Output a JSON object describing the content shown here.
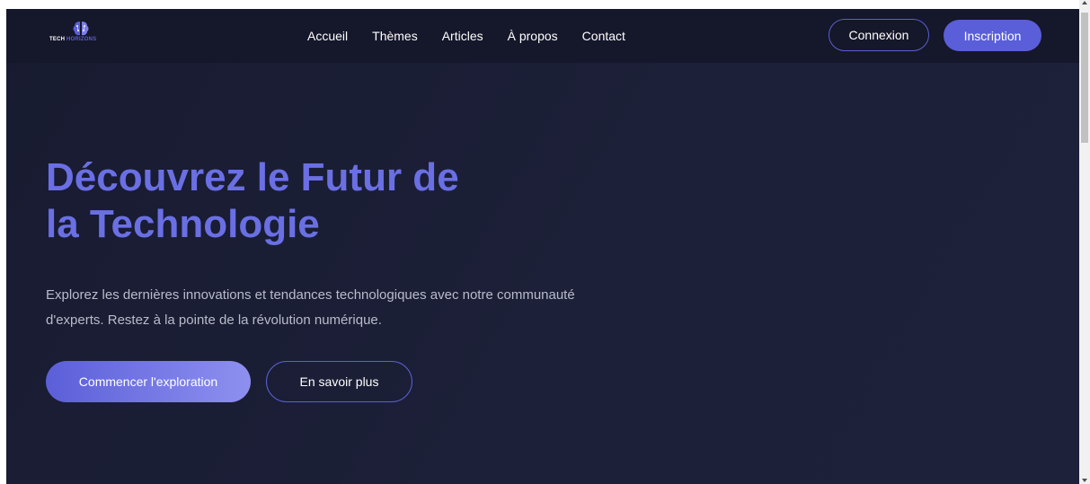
{
  "colors": {
    "background": "#1b1e35",
    "navbar": "#15172a",
    "accent": "#5a5ed8",
    "title": "#6a6fe4",
    "body_text": "#b9bccb"
  },
  "brand": {
    "icon": "brain-circuit-icon",
    "name_part1": "TECH",
    "name_part2": "HORIZONS"
  },
  "nav": {
    "links": [
      "Accueil",
      "Thèmes",
      "Articles",
      "À propos",
      "Contact"
    ],
    "login_label": "Connexion",
    "signup_label": "Inscription"
  },
  "hero": {
    "title": "Découvrez le Futur de\nla Technologie",
    "description": "Explorez les dernières innovations et tendances technologiques avec notre communauté d'experts. Restez à la pointe de la révolution numérique.",
    "primary_cta": "Commencer l'exploration",
    "secondary_cta": "En savoir plus"
  }
}
